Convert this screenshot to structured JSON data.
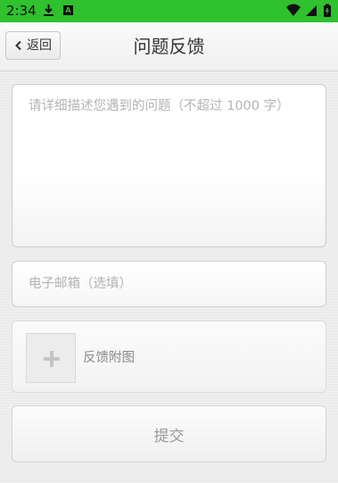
{
  "status_bar": {
    "time": "2:34",
    "notification_letter": "A",
    "color": "#2fc12e",
    "icons": [
      "download-icon",
      "notification-a-icon",
      "wifi-icon",
      "cell-signal-icon",
      "battery-icon"
    ]
  },
  "header": {
    "back_label": "返回",
    "title": "问题反馈"
  },
  "form": {
    "description": {
      "value": "",
      "placeholder": "请详细描述您遇到的问题（不超过 1000 字）"
    },
    "email": {
      "value": "",
      "placeholder": "电子邮箱（选填）"
    },
    "attachment": {
      "label": "反馈附图",
      "add_icon": "plus-icon"
    },
    "submit_label": "提交"
  }
}
